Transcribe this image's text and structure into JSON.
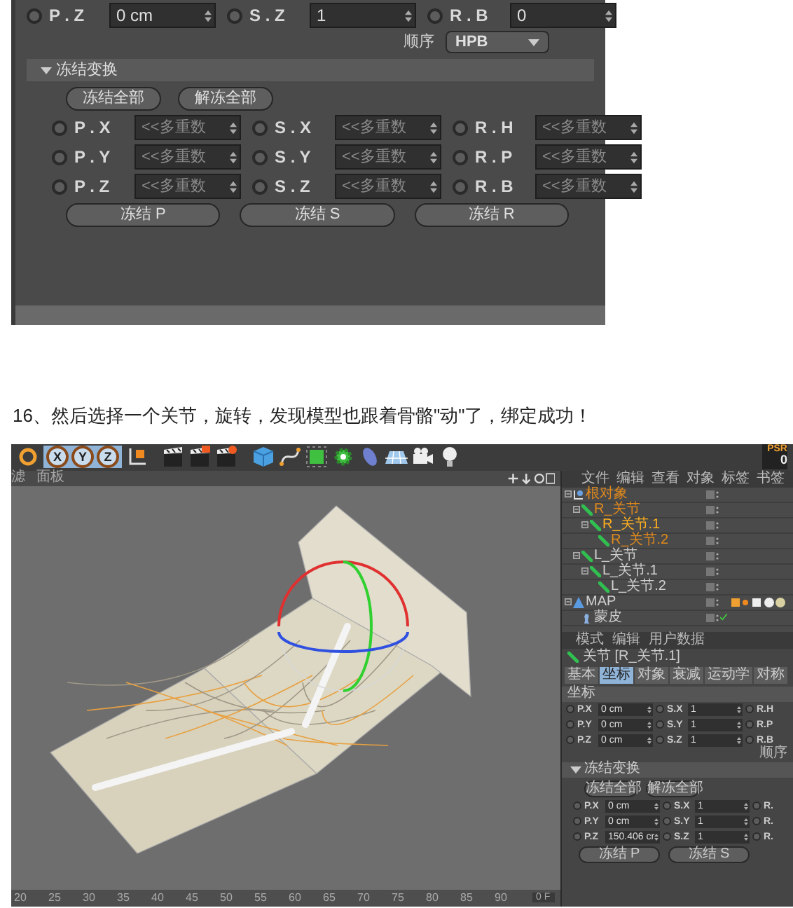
{
  "top_panel": {
    "top_row": [
      {
        "label": "P . Z",
        "value": "0 cm",
        "mixed": false,
        "checked": false
      },
      {
        "label": "S . Z",
        "value": "1",
        "mixed": false,
        "checked": false
      },
      {
        "label": "R . B",
        "value": "0",
        "mixed": false,
        "checked": false
      }
    ],
    "order": {
      "label": "顺序",
      "value": "HPB"
    },
    "freeze": {
      "title": "冻结变换",
      "expanded": true,
      "buttons": [
        "冻结全部",
        "解冻全部"
      ],
      "rows": [
        [
          {
            "label": "P . X",
            "value": "<<多重数",
            "mixed": true,
            "checked": false
          },
          {
            "label": "S . X",
            "value": "<<多重数",
            "mixed": true,
            "checked": false
          },
          {
            "label": "R . H",
            "value": "<<多重数",
            "mixed": true,
            "checked": false
          }
        ],
        [
          {
            "label": "P . Y",
            "value": "<<多重数",
            "mixed": true,
            "checked": false
          },
          {
            "label": "S . Y",
            "value": "<<多重数",
            "mixed": true,
            "checked": false
          },
          {
            "label": "R . P",
            "value": "<<多重数",
            "mixed": true,
            "checked": false
          }
        ],
        [
          {
            "label": "P . Z",
            "value": "<<多重数",
            "mixed": true,
            "checked": false
          },
          {
            "label": "S . Z",
            "value": "<<多重数",
            "mixed": true,
            "checked": false
          },
          {
            "label": "R . B",
            "value": "<<多重数",
            "mixed": true,
            "checked": false
          }
        ]
      ],
      "apply_buttons": [
        "冻结 P",
        "冻结 S",
        "冻结 R"
      ]
    }
  },
  "caption": "16、然后选择一个关节，旋转，发现模型也跟着骨骼\"动\"了，绑定成功！",
  "c4d": {
    "axis_buttons": [
      {
        "label": "X",
        "on": true
      },
      {
        "label": "Y",
        "on": true
      },
      {
        "label": "Z",
        "on": true
      }
    ],
    "psr": {
      "label": "PSR",
      "value": "0"
    },
    "viewport_menu": [
      "滤",
      "面板"
    ],
    "timeline": {
      "ticks": [
        "20",
        "25",
        "30",
        "35",
        "40",
        "45",
        "50",
        "55",
        "60",
        "65",
        "70",
        "75",
        "80",
        "85",
        "90"
      ],
      "frame": "0 F"
    },
    "object_manager": {
      "menu": [
        "文件",
        "编辑",
        "查看",
        "对象",
        "标签",
        "书签"
      ],
      "tree": [
        {
          "name": "根对象",
          "kind": "null",
          "color": "#e0891c",
          "checked": false,
          "children": [
            {
              "name": "R_关节",
              "kind": "joint",
              "color": "#e0891c",
              "checked": false,
              "children": [
                {
                  "name": "R_关节.1",
                  "kind": "joint",
                  "color": "#ffb020",
                  "checked": false,
                  "children": [
                    {
                      "name": "R_关节.2",
                      "kind": "joint",
                      "color": "#e0891c",
                      "checked": false
                    }
                  ]
                }
              ]
            },
            {
              "name": "L_关节",
              "kind": "joint",
              "color": "#d0d0d0",
              "checked": false,
              "children": [
                {
                  "name": "L_关节.1",
                  "kind": "joint",
                  "color": "#d0d0d0",
                  "checked": false,
                  "children": [
                    {
                      "name": "L_关节.2",
                      "kind": "joint",
                      "color": "#d0d0d0",
                      "checked": false
                    }
                  ]
                }
              ]
            }
          ]
        },
        {
          "name": "MAP",
          "kind": "mesh",
          "color": "#d0d0d0",
          "checked": false,
          "children": [
            {
              "name": "蒙皮",
              "kind": "skin",
              "color": "#d0d0d0",
              "checked": true
            }
          ]
        }
      ]
    },
    "attributes": {
      "menu": [
        "模式",
        "编辑",
        "用户数据"
      ],
      "title": "关节 [R_关节.1]",
      "tabs": [
        {
          "label": "基本",
          "selected": false
        },
        {
          "label": "坐标",
          "selected": true
        },
        {
          "label": "对象",
          "selected": false
        },
        {
          "label": "衰减",
          "selected": false
        },
        {
          "label": "运动学",
          "selected": false
        },
        {
          "label": "对称",
          "selected": false
        }
      ],
      "section": "坐标",
      "rows": [
        [
          {
            "label": "P.X",
            "value": "0 cm",
            "checked": false
          },
          {
            "label": "S.X",
            "value": "1",
            "checked": false
          },
          {
            "label": "R.H",
            "checked": false
          }
        ],
        [
          {
            "label": "P.Y",
            "value": "0 cm",
            "checked": false
          },
          {
            "label": "S.Y",
            "value": "1",
            "checked": false
          },
          {
            "label": "R.P",
            "checked": false
          }
        ],
        [
          {
            "label": "P.Z",
            "value": "0 cm",
            "checked": false
          },
          {
            "label": "S.Z",
            "value": "1",
            "checked": false
          },
          {
            "label": "R.B",
            "checked": false
          }
        ]
      ],
      "order_label": "顺序",
      "freeze": {
        "title": "冻结变换",
        "expanded": true,
        "buttons": [
          "冻结全部",
          "解冻全部"
        ],
        "rows": [
          [
            {
              "label": "P.X",
              "value": "0 cm",
              "checked": false
            },
            {
              "label": "S.X",
              "value": "1",
              "checked": false
            },
            {
              "label": "R.",
              "checked": false
            }
          ],
          [
            {
              "label": "P.Y",
              "value": "0 cm",
              "checked": false
            },
            {
              "label": "S.Y",
              "value": "1",
              "checked": false
            },
            {
              "label": "R.",
              "checked": false
            }
          ],
          [
            {
              "label": "P.Z",
              "value": "150.406 cr",
              "checked": false
            },
            {
              "label": "S.Z",
              "value": "1",
              "checked": false
            },
            {
              "label": "R.",
              "checked": false
            }
          ]
        ],
        "apply_buttons": [
          "冻结 P",
          "冻结 S"
        ]
      }
    }
  }
}
